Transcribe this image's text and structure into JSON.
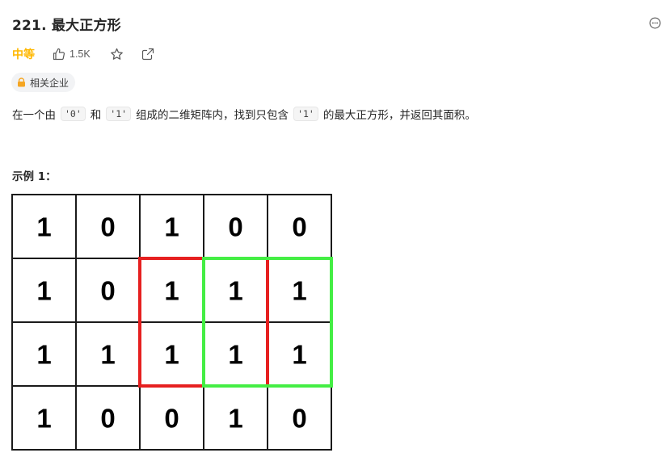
{
  "problem": {
    "title": "221. 最大正方形",
    "difficulty": "中等",
    "likes": "1.5K",
    "related_tag": "相关企业"
  },
  "description": {
    "p1": "在一个由",
    "c1": "'0'",
    "p2": "和",
    "c2": "'1'",
    "p3": "组成的二维矩阵内，找到只包含",
    "c3": "'1'",
    "p4": "的最大正方形，并返回其面积。"
  },
  "example": {
    "title": "示例 1：",
    "matrix": [
      [
        "1",
        "0",
        "1",
        "0",
        "0"
      ],
      [
        "1",
        "0",
        "1",
        "1",
        "1"
      ],
      [
        "1",
        "1",
        "1",
        "1",
        "1"
      ],
      [
        "1",
        "0",
        "0",
        "1",
        "0"
      ]
    ]
  },
  "icons": {
    "more": "more-horizontal-icon",
    "like": "thumbs-up-icon",
    "favorite": "star-icon",
    "share": "share-icon",
    "lock": "lock-icon"
  },
  "colors": {
    "difficulty": "#ffb800",
    "lock": "#f5a623",
    "highlight_red": "#e62020",
    "highlight_green": "#44ee44"
  }
}
